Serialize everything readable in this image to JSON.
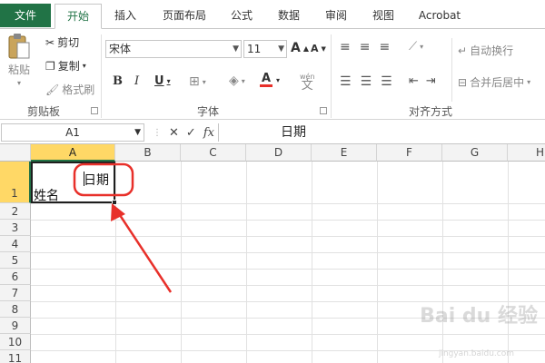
{
  "tabs": [
    "文件",
    "开始",
    "插入",
    "页面布局",
    "公式",
    "数据",
    "审阅",
    "视图",
    "Acrobat"
  ],
  "clipboard": {
    "paste": "粘贴",
    "cut": "剪切",
    "copy": "复制",
    "format_painter": "格式刷",
    "group_label": "剪贴板"
  },
  "font": {
    "name": "宋体",
    "size": "11",
    "bold": "B",
    "italic": "I",
    "underline": "U",
    "color_letter": "A",
    "phonetic": "wén",
    "grow": "A",
    "shrink": "A",
    "group_label": "字体"
  },
  "alignment": {
    "wrap_text": "自动换行",
    "merge_center": "合并后居中",
    "group_label": "对齐方式"
  },
  "formula_bar": {
    "name_box": "A1",
    "cancel": "✕",
    "enter": "✓",
    "fx": "fx",
    "content": "日期"
  },
  "columns": [
    "A",
    "B",
    "C",
    "D",
    "E",
    "F",
    "G",
    "H"
  ],
  "rows": [
    "1",
    "2",
    "3",
    "4",
    "5",
    "6",
    "7",
    "8",
    "9",
    "10",
    "11"
  ],
  "cells": {
    "A1_top": "日期",
    "A1_bottom": "姓名"
  },
  "watermark": {
    "text": "Bai du 经验",
    "sub": "jingyan.baidu.com"
  },
  "colors": {
    "accent": "#217346",
    "selected_header": "#ffd866",
    "annotation": "#e8302a"
  }
}
